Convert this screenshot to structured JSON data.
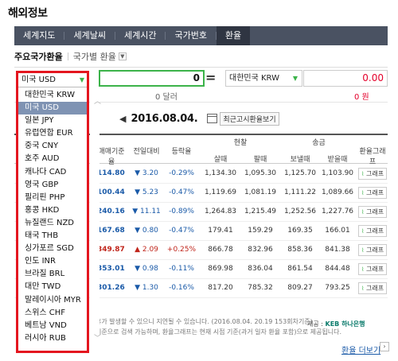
{
  "page_title": "해외정보",
  "tabs": [
    {
      "label": "세계지도"
    },
    {
      "label": "세계날씨"
    },
    {
      "label": "세계시간"
    },
    {
      "label": "국가번호"
    },
    {
      "label": "환율"
    }
  ],
  "subnav": {
    "main": "주요국가환율",
    "alt": "국가별 환율"
  },
  "converter": {
    "from_currency": "미국 USD",
    "from_value": "0",
    "from_sub": "0 달러",
    "to_currency": "대한민국 KRW",
    "to_value": "0.00",
    "to_sub": "0 원"
  },
  "date": {
    "value": "2016.08.04.",
    "recent_label": "최근고시환율보기"
  },
  "table_headers": {
    "base": "매매기준율",
    "change": "전일대비",
    "rate": "등락율",
    "cash": "현찰",
    "cash_buy": "살때",
    "cash_sell": "팔때",
    "transfer": "송금",
    "transfer_send": "보낼때",
    "transfer_recv": "받을때",
    "graph": "환율그래프"
  },
  "rows": [
    {
      "base": "114.80",
      "change": "▼ 3.20",
      "dir": "down",
      "rate": "-0.29%",
      "c1": "1,134.30",
      "c2": "1,095.30",
      "c3": "1,125.70",
      "c4": "1,103.90",
      "graph": "그래프"
    },
    {
      "base": "100.44",
      "change": "▼ 5.23",
      "dir": "down",
      "rate": "-0.47%",
      "c1": "1,119.69",
      "c2": "1,081.19",
      "c3": "1,111.22",
      "c4": "1,089.66",
      "graph": "그래프"
    },
    {
      "base": "240.16",
      "change": "▼ 11.11",
      "dir": "down",
      "rate": "-0.89%",
      "c1": "1,264.83",
      "c2": "1,215.49",
      "c3": "1,252.56",
      "c4": "1,227.76",
      "graph": "그래프"
    },
    {
      "base": "167.68",
      "change": "▼ 0.80",
      "dir": "down",
      "rate": "-0.47%",
      "c1": "179.41",
      "c2": "159.29",
      "c3": "169.35",
      "c4": "166.01",
      "graph": "그래프"
    },
    {
      "base": "349.87",
      "change": "▲ 2.09",
      "dir": "up",
      "rate": "+0.25%",
      "c1": "866.78",
      "c2": "832.96",
      "c3": "858.36",
      "c4": "841.38",
      "graph": "그래프"
    },
    {
      "base": "353.01",
      "change": "▼ 0.98",
      "dir": "down",
      "rate": "-0.11%",
      "c1": "869.98",
      "c2": "836.04",
      "c3": "861.54",
      "c4": "844.48",
      "graph": "그래프"
    },
    {
      "base": "301.26",
      "change": "▼ 1.30",
      "dir": "down",
      "rate": "-0.16%",
      "c1": "817.20",
      "c2": "785.32",
      "c3": "809.27",
      "c4": "793.25",
      "graph": "그래프"
    }
  ],
  "notes": {
    "line1": "휴가 발생할 수 있으니 지연될 수 있습니다. (2016.08.04. 20.19 153회차기준)",
    "line2": "기준으로 검색 가능하며, 환율그래프는 현재 시점 기준(과거 일자 환율 포함)으로 제공됩니다.",
    "provider_prefix": "제공 :",
    "provider": "KEB 하나은행"
  },
  "more_link": "환율 더보기",
  "dropdown": {
    "selected": "미국 USD",
    "items": [
      "대한민국 KRW",
      "미국 USD",
      "일본 JPY",
      "유럽연합 EUR",
      "중국 CNY",
      "호주 AUD",
      "캐나다 CAD",
      "영국 GBP",
      "필리핀 PHP",
      "홍콩 HKD",
      "뉴질랜드 NZD",
      "태국 THB",
      "싱가포르 SGD",
      "인도 INR",
      "브라질 BRL",
      "대만 TWD",
      "말레이시아 MYR",
      "스위스 CHF",
      "베트남 VND",
      "러시아 RUB"
    ]
  },
  "colors": {
    "accent_green": "#3cb34a",
    "highlight_red": "#e4161f",
    "tab_bar": "#4a5262",
    "link_blue": "#1a5aa8"
  }
}
